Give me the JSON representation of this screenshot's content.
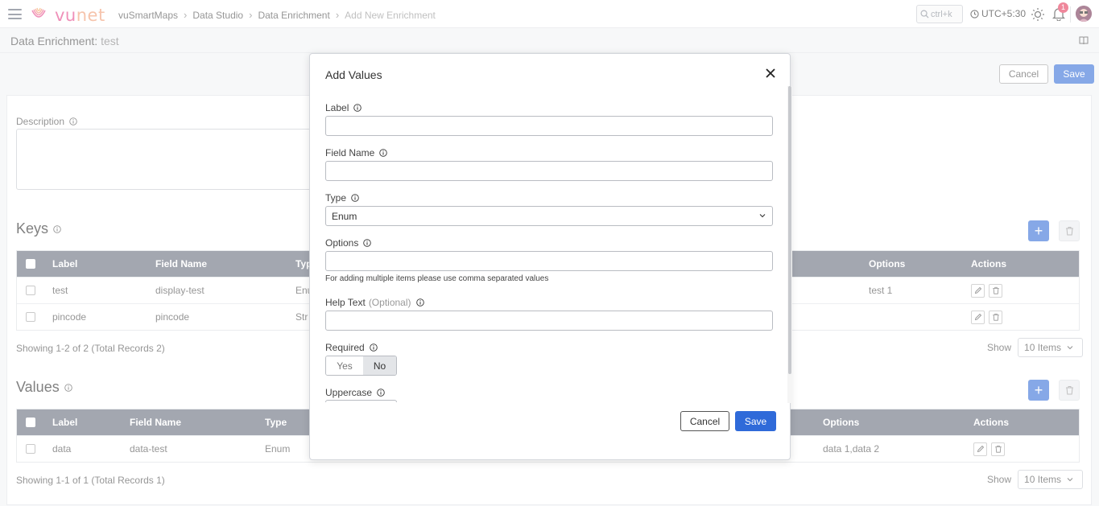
{
  "app": {
    "logo_vu": "vu",
    "logo_net": "net",
    "breadcrumb": [
      "vuSmartMaps",
      "Data Studio",
      "Data Enrichment",
      "Add New Enrichment"
    ],
    "search_placeholder": "ctrl+k",
    "timezone": "UTC+5:30",
    "notification_count": "1"
  },
  "page": {
    "title_prefix": "Data Enrichment:",
    "title_name": "test",
    "cancel_label": "Cancel",
    "save_label": "Save",
    "description_label": "Description"
  },
  "keys": {
    "title": "Keys",
    "columns": [
      "Label",
      "Field Name",
      "Typ",
      "Options",
      "Actions"
    ],
    "rows": [
      {
        "label": "test",
        "field_name": "display-test",
        "type": "Enu",
        "options": "test 1"
      },
      {
        "label": "pincode",
        "field_name": "pincode",
        "type": "Str",
        "options": ""
      }
    ],
    "showing": "Showing 1-2 of 2 (Total Records 2)",
    "show_label": "Show",
    "page_size": "10 Items"
  },
  "values": {
    "title": "Values",
    "columns": [
      "Label",
      "Field Name",
      "Type",
      "Options",
      "Actions"
    ],
    "rows": [
      {
        "label": "data",
        "field_name": "data-test",
        "type": "Enum",
        "options": "data 1,data 2"
      }
    ],
    "showing": "Showing 1-1 of 1 (Total Records 1)",
    "show_label": "Show",
    "page_size": "10 Items"
  },
  "modal": {
    "title": "Add Values",
    "label_label": "Label",
    "label_value": "",
    "field_name_label": "Field Name",
    "field_name_value": "",
    "type_label": "Type",
    "type_value": "Enum",
    "options_label": "Options",
    "options_value": "",
    "options_hint": "For adding multiple items please use comma separated values",
    "help_text_label": "Help Text",
    "help_text_optional": "(Optional)",
    "help_text_value": "",
    "required_label": "Required",
    "required_yes": "Yes",
    "required_no": "No",
    "uppercase_label": "Uppercase",
    "cancel_label": "Cancel",
    "save_label": "Save"
  },
  "colors": {
    "primary": "#2f6ad9",
    "table_header": "#6b7280",
    "badge": "#e53e5e"
  }
}
